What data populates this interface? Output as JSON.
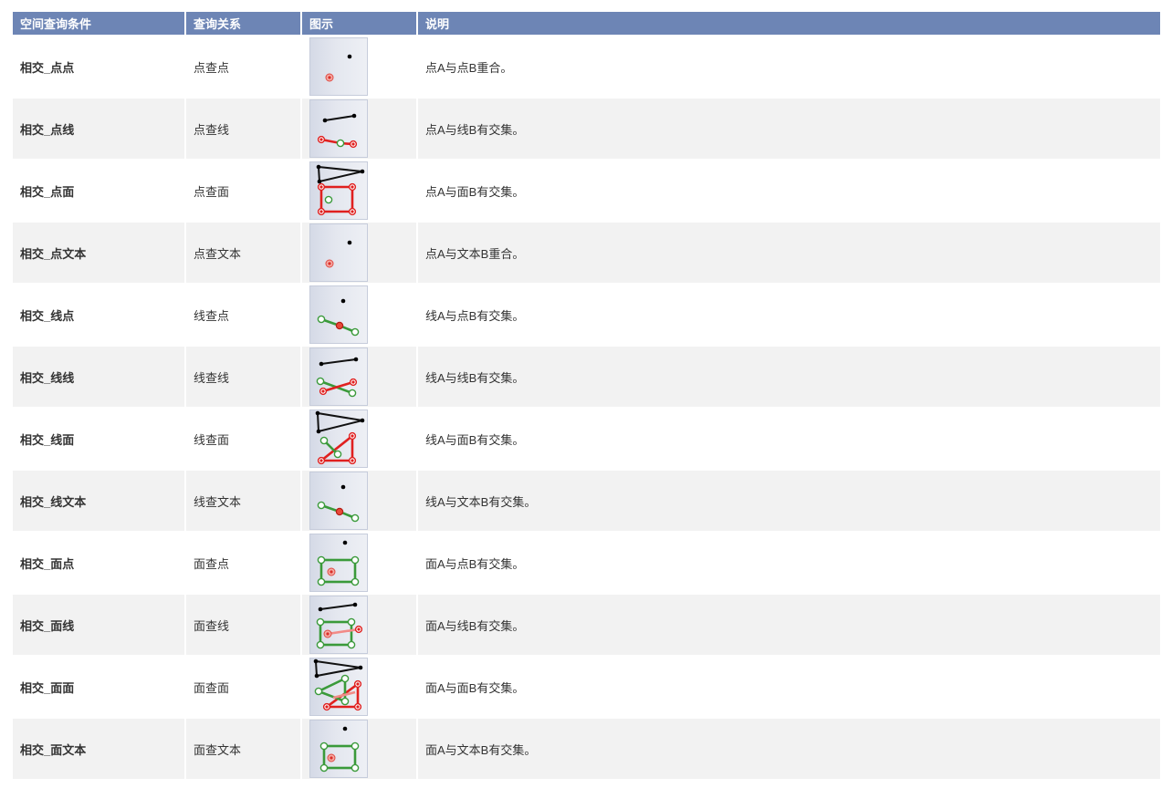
{
  "header": {
    "condition": "空间查询条件",
    "relation": "查询关系",
    "diagram": "图示",
    "description": "说明"
  },
  "rows": [
    {
      "condition": "相交_点点",
      "relation": "点查点",
      "icon": "point-point-intersect-icon",
      "description": "点A与点B重合。"
    },
    {
      "condition": "相交_点线",
      "relation": "点查线",
      "icon": "point-line-intersect-icon",
      "description": "点A与线B有交集。"
    },
    {
      "condition": "相交_点面",
      "relation": "点查面",
      "icon": "point-polygon-intersect-icon",
      "description": "点A与面B有交集。"
    },
    {
      "condition": "相交_点文本",
      "relation": "点查文本",
      "icon": "point-text-intersect-icon",
      "description": "点A与文本B重合。"
    },
    {
      "condition": "相交_线点",
      "relation": "线查点",
      "icon": "line-point-intersect-icon",
      "description": "线A与点B有交集。"
    },
    {
      "condition": "相交_线线",
      "relation": "线查线",
      "icon": "line-line-intersect-icon",
      "description": "线A与线B有交集。"
    },
    {
      "condition": "相交_线面",
      "relation": "线查面",
      "icon": "line-polygon-intersect-icon",
      "description": "线A与面B有交集。"
    },
    {
      "condition": "相交_线文本",
      "relation": "线查文本",
      "icon": "line-text-intersect-icon",
      "description": "线A与文本B有交集。"
    },
    {
      "condition": "相交_面点",
      "relation": "面查点",
      "icon": "polygon-point-intersect-icon",
      "description": "面A与点B有交集。"
    },
    {
      "condition": "相交_面线",
      "relation": "面查线",
      "icon": "polygon-line-intersect-icon",
      "description": "面A与线B有交集。"
    },
    {
      "condition": "相交_面面",
      "relation": "面查面",
      "icon": "polygon-polygon-intersect-icon",
      "description": "面A与面B有交集。"
    },
    {
      "condition": "相交_面文本",
      "relation": "面查文本",
      "icon": "polygon-text-intersect-icon",
      "description": "面A与文本B有交集。"
    }
  ],
  "colors": {
    "header_bg": "#6d85b5",
    "header_text": "#ffffff",
    "row_alt_bg": "#f2f2f2",
    "text": "#333333",
    "shape_a": "#3a9a3a",
    "shape_b": "#e0201f",
    "query_shape": "#111111"
  }
}
